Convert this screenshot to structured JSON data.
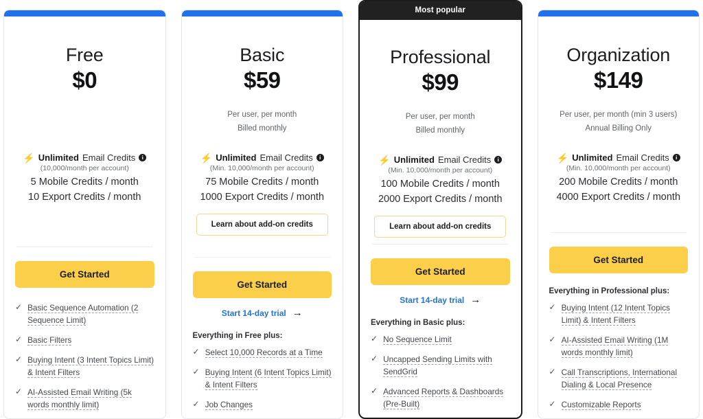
{
  "colors": {
    "accent_blue": "#1f72eb",
    "cta_yellow": "#fbcf49",
    "badge_dark": "#212121",
    "bolt_orange": "#f28c28",
    "link_blue": "#2573cc",
    "addon_border": "#f0d795"
  },
  "icons": {
    "bolt": "⚡",
    "info": "i",
    "check": "✓",
    "arrow": "→"
  },
  "labels": {
    "get_started": "Get Started",
    "addon_credits": "Learn about add-on credits",
    "trial": "Start 14-day trial",
    "most_popular": "Most popular"
  },
  "plans": [
    {
      "name": "Free",
      "price": "$0",
      "billing_line_1": "",
      "billing_line_2": "",
      "badge": "",
      "featured": false,
      "email_credits_strong": "Unlimited",
      "email_credits_rest": "Email Credits",
      "email_credits_sub": "(10,000/month per account)",
      "mobile_credits": "5 Mobile Credits / month",
      "export_credits": "10 Export Credits / month",
      "has_addon_button": false,
      "has_trial_link": false,
      "features_heading": "",
      "features": [
        "Basic Sequence Automation (2 Sequence Limit)",
        "Basic Filters",
        "Buying Intent (3 Intent Topics Limit) & Intent Filters",
        "AI-Assisted Email Writing (5k words monthly limit)"
      ]
    },
    {
      "name": "Basic",
      "price": "$59",
      "billing_line_1": "Per user, per month",
      "billing_line_2": "Billed monthly",
      "badge": "",
      "featured": false,
      "email_credits_strong": "Unlimited",
      "email_credits_rest": "Email Credits",
      "email_credits_sub": "(Min. 10,000/month per account)",
      "mobile_credits": "75 Mobile Credits / month",
      "export_credits": "1000 Export Credits / month",
      "has_addon_button": true,
      "has_trial_link": true,
      "features_heading": "Everything in Free plus:",
      "features": [
        "Select 10,000 Records at a Time",
        "Buying Intent (6 Intent Topics Limit) & Intent Filters",
        "Job Changes"
      ]
    },
    {
      "name": "Professional",
      "price": "$99",
      "billing_line_1": "Per user, per month",
      "billing_line_2": "Billed monthly",
      "badge": "Most popular",
      "featured": true,
      "email_credits_strong": "Unlimited",
      "email_credits_rest": "Email Credits",
      "email_credits_sub": "(Min. 10,000/month per account)",
      "mobile_credits": "100 Mobile Credits / month",
      "export_credits": "2000 Export Credits / month",
      "has_addon_button": true,
      "has_trial_link": true,
      "features_heading": "Everything in Basic plus:",
      "features": [
        "No Sequence Limit",
        "Uncapped Sending Limits with SendGrid",
        "Advanced Reports & Dashboards (Pre-Built)"
      ]
    },
    {
      "name": "Organization",
      "price": "$149",
      "billing_line_1": "Per user, per month (min 3 users)",
      "billing_line_2": "Annual Billing Only",
      "badge": "",
      "featured": false,
      "email_credits_strong": "Unlimited",
      "email_credits_rest": "Email Credits",
      "email_credits_sub": "(Min. 10,000/month per account)",
      "mobile_credits": "200 Mobile Credits / month",
      "export_credits": "4000 Export Credits / month",
      "has_addon_button": false,
      "has_trial_link": false,
      "features_heading": "Everything in Professional plus:",
      "features": [
        "Buying Intent (12 Intent Topics Limit) & Intent Filters",
        "AI-Assisted Email Writing (1M words monthly limit)",
        "Call Transcriptions, International Dialing & Local Presence",
        "Customizable Reports"
      ]
    }
  ]
}
